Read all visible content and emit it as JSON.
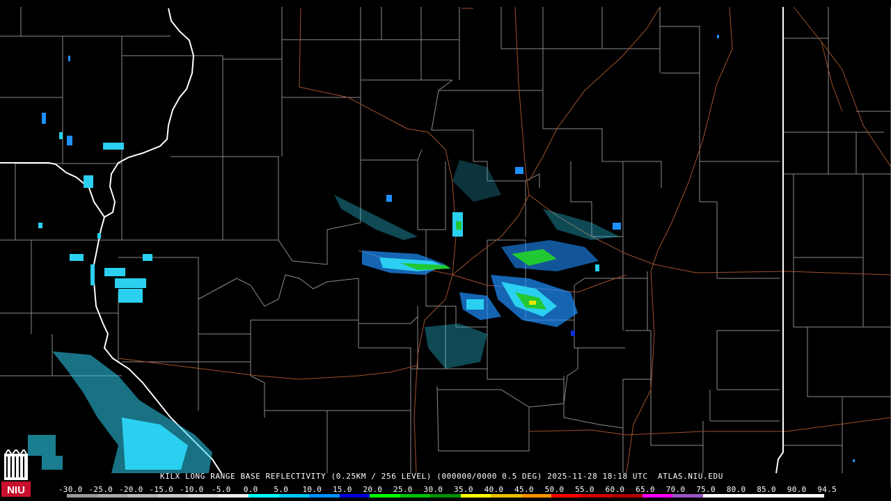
{
  "product": {
    "caption": "KILX LONG RANGE BASE REFLECTIVITY (0.25KM / 256 LEVEL) (000000/0000 0.5 DEG) 2025-11-28 18:18 UTC  ATLAS.NIU.EDU"
  },
  "legend": {
    "ticks": [
      "-30.0",
      "-25.0",
      "-20.0",
      "-15.0",
      "-10.0",
      "-5.0",
      "0.0",
      "5.0",
      "10.0",
      "15.0",
      "20.0",
      "25.0",
      "30.0",
      "35.0",
      "40.0",
      "45.0",
      "50.0",
      "55.0",
      "60.0",
      "65.0",
      "70.0",
      "75.0",
      "80.0",
      "85.0",
      "90.0",
      "94.5"
    ],
    "colors": [
      "#9a9a9a",
      "#a8a8a8",
      "#b8b8b8",
      "#cacaca",
      "#dcdcdc",
      "#eeeeee",
      "#00ffff",
      "#00c8ff",
      "#0090ff",
      "#0000e0",
      "#00ff00",
      "#00c000",
      "#009000",
      "#ffff00",
      "#e6c000",
      "#ff9000",
      "#ff0000",
      "#d00000",
      "#b00000",
      "#ff00ff",
      "#9955c9",
      "#ffffff",
      "#ffffff",
      "#ffffff",
      "#ffffff"
    ]
  },
  "map_colors": {
    "background": "#000000",
    "county_lines": "#8c8c8c",
    "state_lines": "#ffffff",
    "highways": "#a0522d",
    "echo_light": "#2bd0f0",
    "echo_mid": "#1e90ff",
    "echo_green": "#22c833",
    "echo_yellow": "#e6e600",
    "echo_dark_blue": "#1030d0"
  },
  "logo": {
    "text": "NIU",
    "color": "#c8102e"
  }
}
